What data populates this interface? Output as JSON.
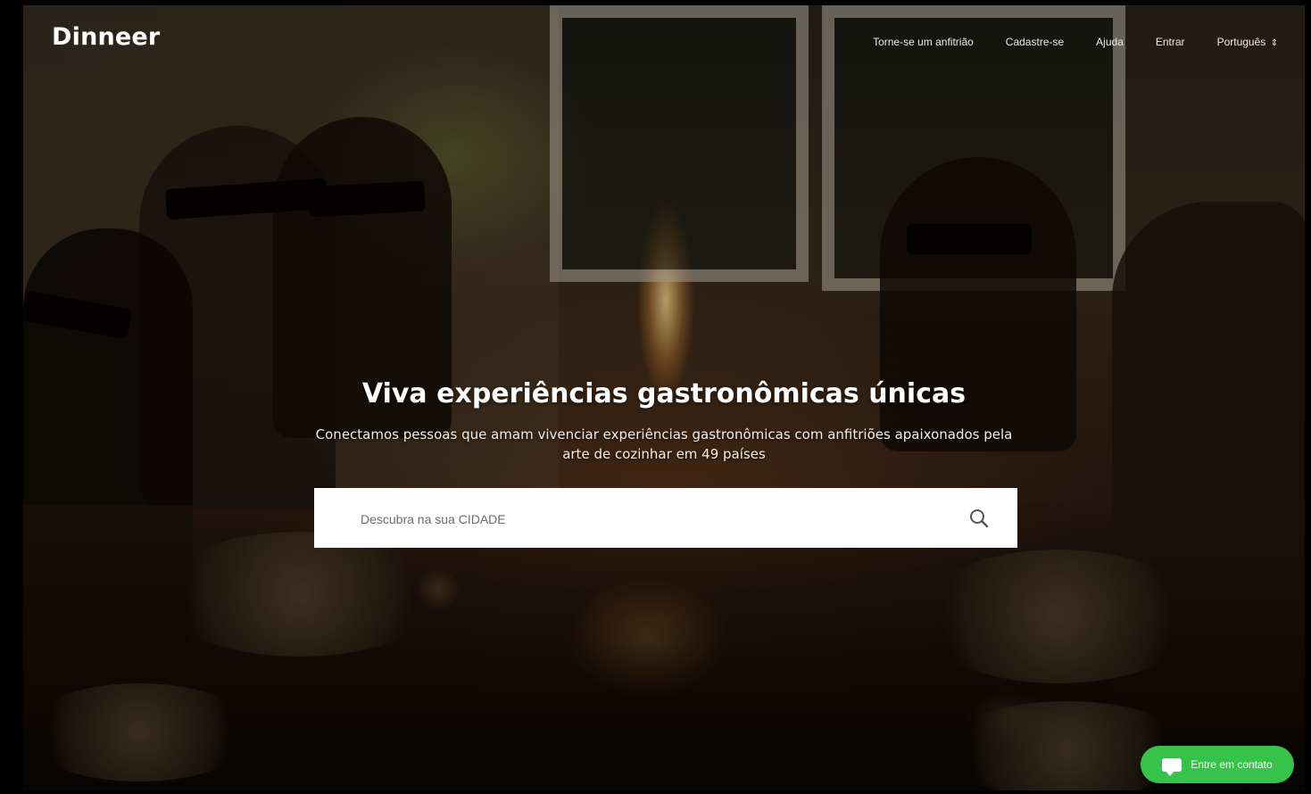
{
  "header": {
    "logo": "Dinneer",
    "nav": {
      "host": "Torne-se um anfitrião",
      "signup": "Cadastre-se",
      "help": "Ajuda",
      "login": "Entrar",
      "language": "Português",
      "language_arrow": "⇕"
    }
  },
  "hero": {
    "title": "Viva experiências gastronômicas únicas",
    "subtitle": "Conectamos pessoas que amam vivenciar experiências gastronômicas com anfitriões apaixonados pela arte de cozinhar em 49 países"
  },
  "search": {
    "placeholder": "Descubra na sua CIDADE",
    "icon": "search-icon"
  },
  "contact": {
    "label": "Entre em contato",
    "icon": "chat-icon",
    "color": "#37c24a"
  }
}
